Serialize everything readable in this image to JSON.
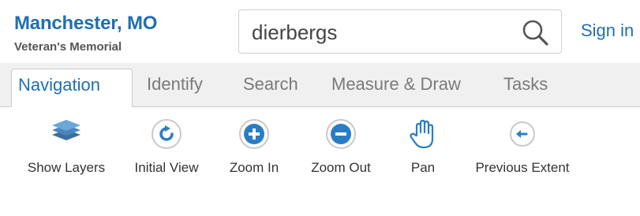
{
  "header": {
    "title": "Manchester, MO",
    "subtitle": "Veteran's Memorial",
    "search_value": "dierbergs",
    "sign_in": "Sign in"
  },
  "tabs": [
    {
      "label": "Navigation",
      "active": true
    },
    {
      "label": "Identify",
      "active": false
    },
    {
      "label": "Search",
      "active": false
    },
    {
      "label": "Measure & Draw",
      "active": false
    },
    {
      "label": "Tasks",
      "active": false
    }
  ],
  "toolbar": [
    {
      "label": "Show Layers",
      "icon": "layers-icon"
    },
    {
      "label": "Initial View",
      "icon": "refresh-icon"
    },
    {
      "label": "Zoom In",
      "icon": "plus-circle-icon"
    },
    {
      "label": "Zoom Out",
      "icon": "minus-circle-icon"
    },
    {
      "label": "Pan",
      "icon": "hand-icon"
    },
    {
      "label": "Previous Extent",
      "icon": "back-arrow-icon"
    }
  ],
  "colors": {
    "accent": "#1f6fb3",
    "icon_blue": "#2a7dc4"
  }
}
